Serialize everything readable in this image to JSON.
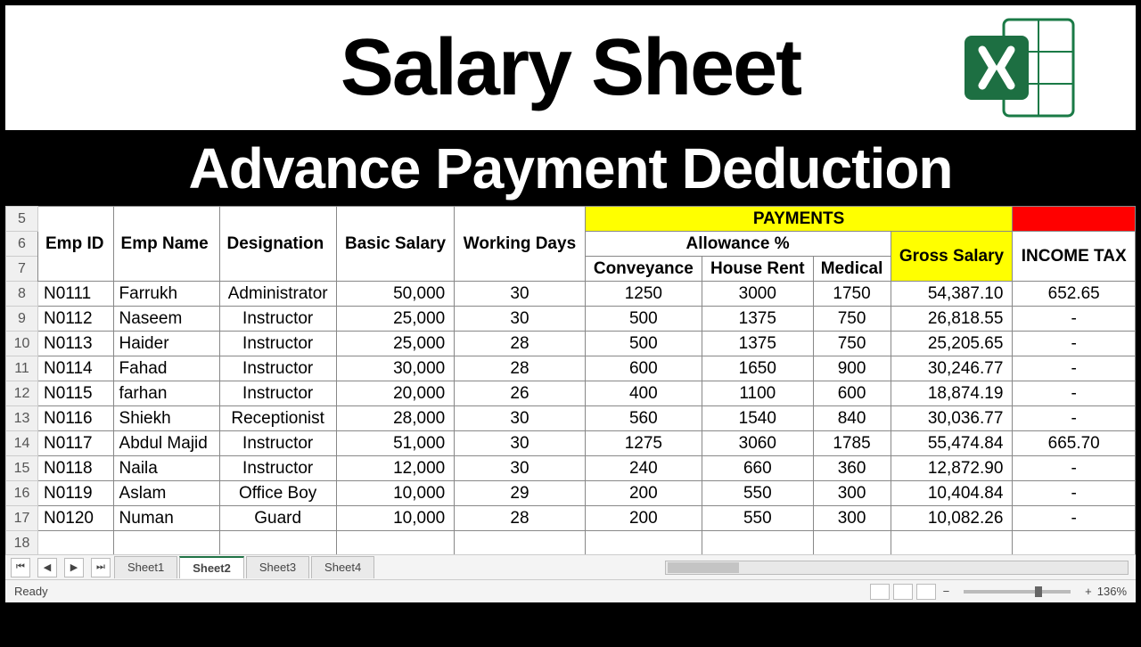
{
  "title": "Salary Sheet",
  "subtitle": "Advance Payment Deduction",
  "headers": {
    "emp_id": "Emp ID",
    "emp_name": "Emp Name",
    "designation": "Designation",
    "basic_salary": "Basic Salary",
    "working_days": "Working Days",
    "payments": "PAYMENTS",
    "allowance": "Allowance %",
    "conveyance": "Conveyance",
    "house_rent": "House Rent",
    "medical": "Medical",
    "gross_salary": "Gross Salary",
    "income_tax": "INCOME TAX"
  },
  "row_labels": [
    "5",
    "6",
    "7",
    "8",
    "9",
    "10",
    "11",
    "12",
    "13",
    "14",
    "15",
    "16",
    "17",
    "18"
  ],
  "rows": [
    {
      "id": "N0111",
      "name": "Farrukh",
      "desig": "Administrator",
      "basic": "50,000",
      "days": "30",
      "conv": "1250",
      "rent": "3000",
      "med": "1750",
      "gross": "54,387.10",
      "tax": "652.65"
    },
    {
      "id": "N0112",
      "name": "Naseem",
      "desig": "Instructor",
      "basic": "25,000",
      "days": "30",
      "conv": "500",
      "rent": "1375",
      "med": "750",
      "gross": "26,818.55",
      "tax": "-"
    },
    {
      "id": "N0113",
      "name": "Haider",
      "desig": "Instructor",
      "basic": "25,000",
      "days": "28",
      "conv": "500",
      "rent": "1375",
      "med": "750",
      "gross": "25,205.65",
      "tax": "-"
    },
    {
      "id": "N0114",
      "name": "Fahad",
      "desig": "Instructor",
      "basic": "30,000",
      "days": "28",
      "conv": "600",
      "rent": "1650",
      "med": "900",
      "gross": "30,246.77",
      "tax": "-"
    },
    {
      "id": "N0115",
      "name": "farhan",
      "desig": "Instructor",
      "basic": "20,000",
      "days": "26",
      "conv": "400",
      "rent": "1100",
      "med": "600",
      "gross": "18,874.19",
      "tax": "-"
    },
    {
      "id": "N0116",
      "name": "Shiekh",
      "desig": "Receptionist",
      "basic": "28,000",
      "days": "30",
      "conv": "560",
      "rent": "1540",
      "med": "840",
      "gross": "30,036.77",
      "tax": "-"
    },
    {
      "id": "N0117",
      "name": "Abdul Majid",
      "desig": "Instructor",
      "basic": "51,000",
      "days": "30",
      "conv": "1275",
      "rent": "3060",
      "med": "1785",
      "gross": "55,474.84",
      "tax": "665.70"
    },
    {
      "id": "N0118",
      "name": "Naila",
      "desig": "Instructor",
      "basic": "12,000",
      "days": "30",
      "conv": "240",
      "rent": "660",
      "med": "360",
      "gross": "12,872.90",
      "tax": "-"
    },
    {
      "id": "N0119",
      "name": "Aslam",
      "desig": "Office Boy",
      "basic": "10,000",
      "days": "29",
      "conv": "200",
      "rent": "550",
      "med": "300",
      "gross": "10,404.84",
      "tax": "-"
    },
    {
      "id": "N0120",
      "name": "Numan",
      "desig": "Guard",
      "basic": "10,000",
      "days": "28",
      "conv": "200",
      "rent": "550",
      "med": "300",
      "gross": "10,082.26",
      "tax": "-"
    }
  ],
  "tabs": [
    "Sheet1",
    "Sheet2",
    "Sheet3",
    "Sheet4"
  ],
  "active_tab": 1,
  "status": {
    "ready": "Ready",
    "zoom": "136%"
  }
}
